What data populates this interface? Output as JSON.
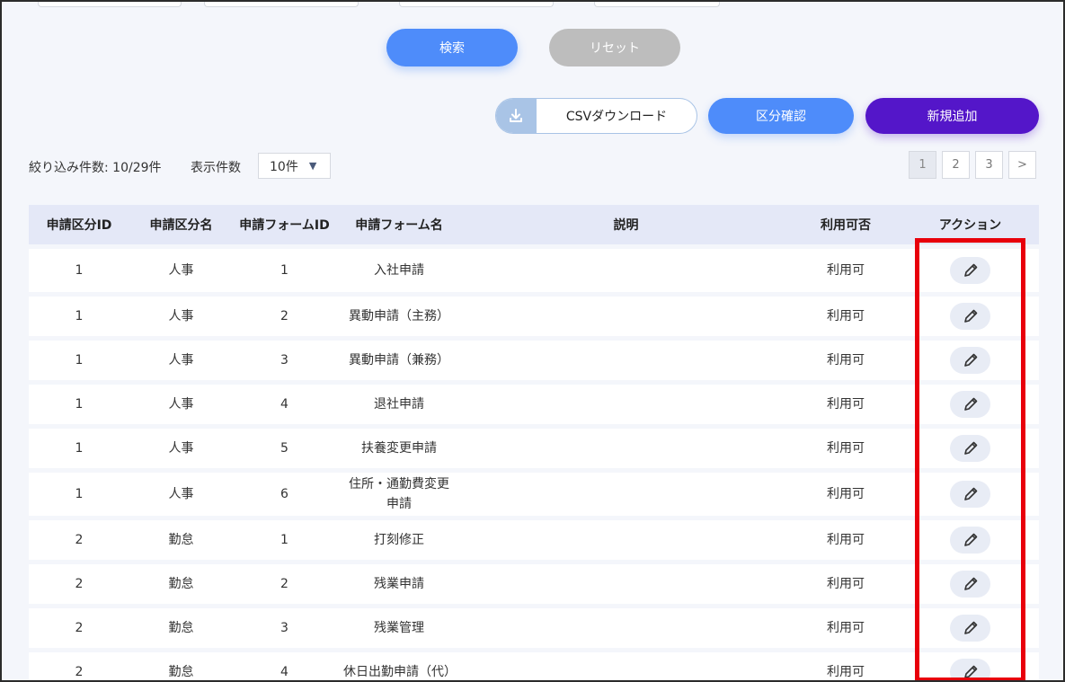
{
  "buttons": {
    "search": "検索",
    "reset": "リセット",
    "csv": "CSVダウンロード",
    "category_check": "区分確認",
    "add_new": "新規追加"
  },
  "meta": {
    "filter_count": "絞り込み件数: 10/29件",
    "per_page_label": "表示件数",
    "per_page_value": "10件"
  },
  "pagination": {
    "pages": [
      "1",
      "2",
      "3"
    ],
    "next": ">",
    "current": 1
  },
  "table": {
    "headers": [
      "申請区分ID",
      "申請区分名",
      "申請フォームID",
      "申請フォーム名",
      "説明",
      "利用可否",
      "アクション"
    ],
    "rows": [
      {
        "cat_id": "1",
        "cat_name": "人事",
        "form_id": "1",
        "form_name": "入社申請",
        "desc": "",
        "avail": "利用可"
      },
      {
        "cat_id": "1",
        "cat_name": "人事",
        "form_id": "2",
        "form_name": "異動申請（主務）",
        "desc": "",
        "avail": "利用可"
      },
      {
        "cat_id": "1",
        "cat_name": "人事",
        "form_id": "3",
        "form_name": "異動申請（兼務）",
        "desc": "",
        "avail": "利用可"
      },
      {
        "cat_id": "1",
        "cat_name": "人事",
        "form_id": "4",
        "form_name": "退社申請",
        "desc": "",
        "avail": "利用可"
      },
      {
        "cat_id": "1",
        "cat_name": "人事",
        "form_id": "5",
        "form_name": "扶養変更申請",
        "desc": "",
        "avail": "利用可"
      },
      {
        "cat_id": "1",
        "cat_name": "人事",
        "form_id": "6",
        "form_name": "住所・通勤費変更申請",
        "desc": "",
        "avail": "利用可"
      },
      {
        "cat_id": "2",
        "cat_name": "勤怠",
        "form_id": "1",
        "form_name": "打刻修正",
        "desc": "",
        "avail": "利用可"
      },
      {
        "cat_id": "2",
        "cat_name": "勤怠",
        "form_id": "2",
        "form_name": "残業申請",
        "desc": "",
        "avail": "利用可"
      },
      {
        "cat_id": "2",
        "cat_name": "勤怠",
        "form_id": "3",
        "form_name": "残業管理",
        "desc": "",
        "avail": "利用可"
      },
      {
        "cat_id": "2",
        "cat_name": "勤怠",
        "form_id": "4",
        "form_name": "休日出勤申請（代）",
        "desc": "",
        "avail": "利用可"
      }
    ]
  },
  "icons": {
    "download": "download-icon",
    "edit": "pencil-icon",
    "caret": "caret-down-icon"
  },
  "colors": {
    "primary": "#4e8cfa",
    "purple": "#5416c9",
    "reset_gray": "#bdbdbd",
    "highlight_red": "#e8000b",
    "header_bg": "#e4e8f7"
  }
}
